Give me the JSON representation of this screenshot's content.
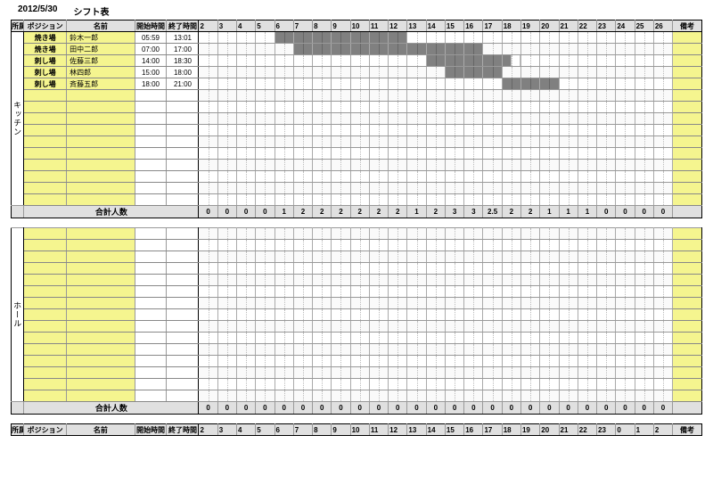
{
  "header": {
    "date": "2012/5/30",
    "title": "シフト表"
  },
  "columns": {
    "dept": "所属",
    "position": "ポジション",
    "name": "名前",
    "start": "開始時間",
    "end": "終了時間",
    "hours": [
      "2",
      "3",
      "4",
      "5",
      "6",
      "7",
      "8",
      "9",
      "10",
      "11",
      "12",
      "13",
      "14",
      "15",
      "16",
      "17",
      "18",
      "19",
      "20",
      "21",
      "22",
      "23",
      "24",
      "25",
      "26"
    ],
    "remark": "備考"
  },
  "sections": [
    {
      "dept": "キッチン",
      "rows_count": 15,
      "staff": [
        {
          "position": "焼き場",
          "name": "鈴木一郎",
          "start": "05:59",
          "end": "13:01",
          "bar": [
            6,
            13,
            false,
            false
          ]
        },
        {
          "position": "焼き場",
          "name": "田中二郎",
          "start": "07:00",
          "end": "17:00",
          "bar": [
            7,
            17,
            false,
            false
          ]
        },
        {
          "position": "刺し場",
          "name": "佐藤三郎",
          "start": "14:00",
          "end": "18:30",
          "bar": [
            14,
            18,
            false,
            true
          ]
        },
        {
          "position": "刺し場",
          "name": "林四郎",
          "start": "15:00",
          "end": "18:00",
          "bar": [
            15,
            18,
            false,
            false
          ]
        },
        {
          "position": "刺し場",
          "name": "斉藤五郎",
          "start": "18:00",
          "end": "21:00",
          "bar": [
            18,
            21,
            false,
            false
          ]
        }
      ],
      "totals_label": "合計人数",
      "totals": [
        "0",
        "0",
        "0",
        "0",
        "1",
        "2",
        "2",
        "2",
        "2",
        "2",
        "2",
        "1",
        "2",
        "3",
        "3",
        "2.5",
        "2",
        "2",
        "1",
        "1",
        "1",
        "0",
        "0",
        "0",
        "0"
      ]
    },
    {
      "dept": "ホール",
      "rows_count": 15,
      "staff": [],
      "totals_label": "合計人数",
      "totals": [
        "0",
        "0",
        "0",
        "0",
        "0",
        "0",
        "0",
        "0",
        "0",
        "0",
        "0",
        "0",
        "0",
        "0",
        "0",
        "0",
        "0",
        "0",
        "0",
        "0",
        "0",
        "0",
        "0",
        "0",
        "0"
      ]
    }
  ],
  "footer": {
    "position": "ポジション",
    "name": "名前",
    "start": "開始時間",
    "end": "終了時間",
    "hours": [
      "2",
      "3",
      "4",
      "5",
      "6",
      "7",
      "8",
      "9",
      "10",
      "11",
      "12",
      "13",
      "14",
      "15",
      "16",
      "17",
      "18",
      "19",
      "20",
      "21",
      "22",
      "23",
      "0",
      "1",
      "2"
    ],
    "remark": "備考"
  },
  "chart_data": {
    "type": "table",
    "title": "シフト表 2012/5/30",
    "sections": [
      {
        "dept": "キッチン",
        "series": [
          {
            "name": "鈴木一郎",
            "position": "焼き場",
            "start": 5.98,
            "end": 13.02
          },
          {
            "name": "田中二郎",
            "position": "焼き場",
            "start": 7,
            "end": 17
          },
          {
            "name": "佐藤三郎",
            "position": "刺し場",
            "start": 14,
            "end": 18.5
          },
          {
            "name": "林四郎",
            "position": "刺し場",
            "start": 15,
            "end": 18
          },
          {
            "name": "斉藤五郎",
            "position": "刺し場",
            "start": 18,
            "end": 21
          }
        ],
        "hours": [
          2,
          3,
          4,
          5,
          6,
          7,
          8,
          9,
          10,
          11,
          12,
          13,
          14,
          15,
          16,
          17,
          18,
          19,
          20,
          21,
          22,
          23,
          24,
          25,
          26
        ],
        "totals": [
          0,
          0,
          0,
          0,
          1,
          2,
          2,
          2,
          2,
          2,
          2,
          1,
          2,
          3,
          3,
          2.5,
          2,
          2,
          1,
          1,
          1,
          0,
          0,
          0,
          0
        ]
      },
      {
        "dept": "ホール",
        "series": [],
        "hours": [
          2,
          3,
          4,
          5,
          6,
          7,
          8,
          9,
          10,
          11,
          12,
          13,
          14,
          15,
          16,
          17,
          18,
          19,
          20,
          21,
          22,
          23,
          24,
          25,
          26
        ],
        "totals": [
          0,
          0,
          0,
          0,
          0,
          0,
          0,
          0,
          0,
          0,
          0,
          0,
          0,
          0,
          0,
          0,
          0,
          0,
          0,
          0,
          0,
          0,
          0,
          0,
          0
        ]
      }
    ]
  }
}
